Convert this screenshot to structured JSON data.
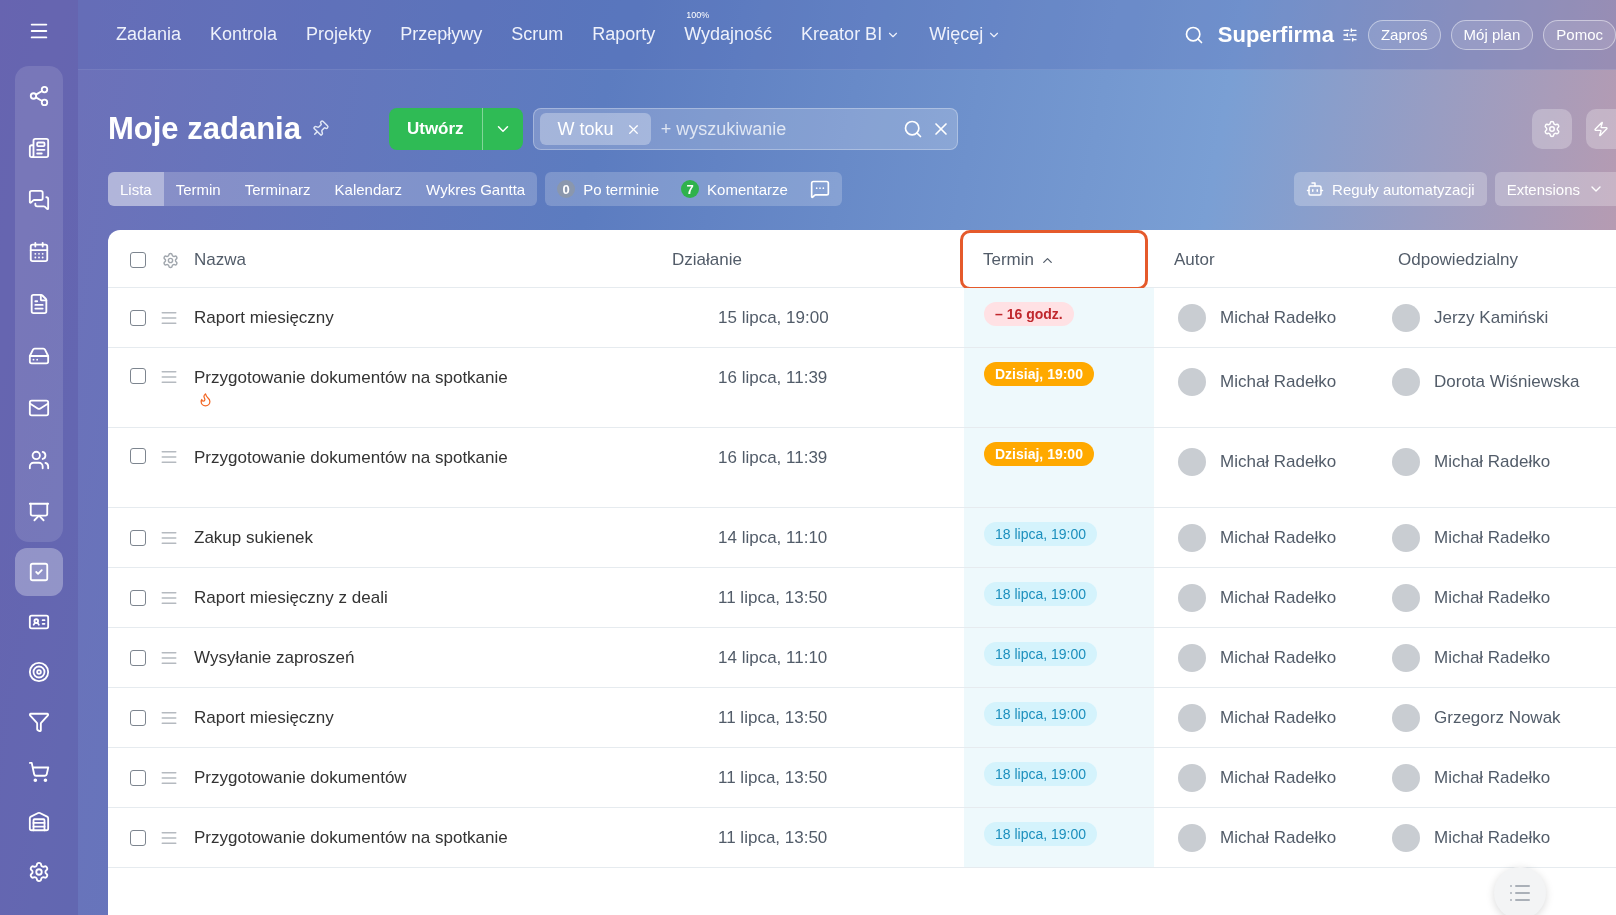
{
  "nav": {
    "items": [
      {
        "label": "Zadania",
        "dropdown": false
      },
      {
        "label": "Kontrola",
        "dropdown": false
      },
      {
        "label": "Projekty",
        "dropdown": false
      },
      {
        "label": "Przepływy",
        "dropdown": false
      },
      {
        "label": "Scrum",
        "dropdown": false
      },
      {
        "label": "Raporty",
        "dropdown": false
      },
      {
        "label": "Wydajność",
        "dropdown": false,
        "superscript": "100%"
      },
      {
        "label": "Kreator BI",
        "dropdown": true
      },
      {
        "label": "Więcej",
        "dropdown": true
      }
    ],
    "company": "Superfirma",
    "buttons": [
      "Zaproś",
      "Mój plan",
      "Pomoc"
    ]
  },
  "sidebar": {
    "items": [
      {
        "selected": false
      },
      {
        "selected": false
      },
      {
        "selected": false
      },
      {
        "selected": false
      },
      {
        "selected": false
      },
      {
        "selected": false
      },
      {
        "selected": false
      },
      {
        "selected": false
      },
      {
        "selected": false
      },
      {
        "selected": true
      },
      {
        "selected": false
      },
      {
        "selected": false
      },
      {
        "selected": false
      },
      {
        "selected": false
      },
      {
        "selected": false
      },
      {
        "selected": false
      }
    ]
  },
  "header": {
    "title": "Moje zadania",
    "create_button": "Utwórz",
    "filter_chip": "W toku",
    "search_placeholder": "+ wyszukiwanie"
  },
  "views": [
    {
      "label": "Lista",
      "selected": true
    },
    {
      "label": "Termin",
      "selected": false
    },
    {
      "label": "Terminarz",
      "selected": false
    },
    {
      "label": "Kalendarz",
      "selected": false
    },
    {
      "label": "Wykres Gantta",
      "selected": false
    }
  ],
  "counters": [
    {
      "count": "0",
      "label": "Po terminie",
      "color": "#8a97ad"
    },
    {
      "count": "7",
      "label": "Komentarze",
      "color": "#2fb24c"
    }
  ],
  "right_buttons": {
    "automation": "Reguły automatyzacji",
    "extensions": "Extensions"
  },
  "table": {
    "select_all_checked": false,
    "columns": [
      {
        "label": "Nazwa",
        "sorted": false
      },
      {
        "label": "Działanie",
        "sorted": false
      },
      {
        "label": "Termin",
        "sorted": true
      },
      {
        "label": "Autor",
        "sorted": false
      },
      {
        "label": "Odpowiedzialny",
        "sorted": false
      }
    ],
    "rows": [
      {
        "checked": false,
        "name": "Raport miesięczny",
        "urgent": false,
        "activity": "15 lipca, 19:00",
        "deadline": {
          "text": "– 16 godz.",
          "kind": "overdue"
        },
        "author": "Michał Radełko",
        "responsible": "Jerzy Kamiński"
      },
      {
        "checked": false,
        "name": "Przygotowanie dokumentów na spotkanie",
        "urgent": true,
        "activity": "16 lipca, 11:39",
        "deadline": {
          "text": "Dzisiaj, 19:00",
          "kind": "today"
        },
        "author": "Michał Radełko",
        "responsible": "Dorota Wiśniewska"
      },
      {
        "checked": false,
        "name": "Przygotowanie dokumentów na spotkanie",
        "urgent": false,
        "tall": true,
        "activity": "16 lipca, 11:39",
        "deadline": {
          "text": "Dzisiaj, 19:00",
          "kind": "today"
        },
        "author": "Michał Radełko",
        "responsible": "Michał Radełko"
      },
      {
        "checked": false,
        "name": "Zakup sukienek",
        "urgent": false,
        "activity": "14 lipca, 11:10",
        "deadline": {
          "text": "18 lipca, 19:00",
          "kind": "future"
        },
        "author": "Michał Radełko",
        "responsible": "Michał Radełko"
      },
      {
        "checked": false,
        "name": "Raport miesięczny z deali",
        "urgent": false,
        "activity": "11 lipca, 13:50",
        "deadline": {
          "text": "18 lipca, 19:00",
          "kind": "future"
        },
        "author": "Michał Radełko",
        "responsible": "Michał Radełko"
      },
      {
        "checked": false,
        "name": "Wysyłanie zaproszeń",
        "urgent": false,
        "activity": "14 lipca, 11:10",
        "deadline": {
          "text": "18 lipca, 19:00",
          "kind": "future"
        },
        "author": "Michał Radełko",
        "responsible": "Michał Radełko"
      },
      {
        "checked": false,
        "name": "Raport miesięczny",
        "urgent": false,
        "activity": "11 lipca, 13:50",
        "deadline": {
          "text": "18 lipca, 19:00",
          "kind": "future"
        },
        "author": "Michał Radełko",
        "responsible": "Grzegorz Nowak"
      },
      {
        "checked": false,
        "name": "Przygotowanie dokumentów",
        "urgent": false,
        "activity": "11 lipca, 13:50",
        "deadline": {
          "text": "18 lipca, 19:00",
          "kind": "future"
        },
        "author": "Michał Radełko",
        "responsible": "Michał Radełko"
      },
      {
        "checked": false,
        "name": "Przygotowanie dokumentów na spotkanie",
        "urgent": false,
        "activity": "11 lipca, 13:50",
        "deadline": {
          "text": "18 lipca, 19:00",
          "kind": "future"
        },
        "author": "Michał Radełko",
        "responsible": "Michał Radełko"
      }
    ]
  }
}
